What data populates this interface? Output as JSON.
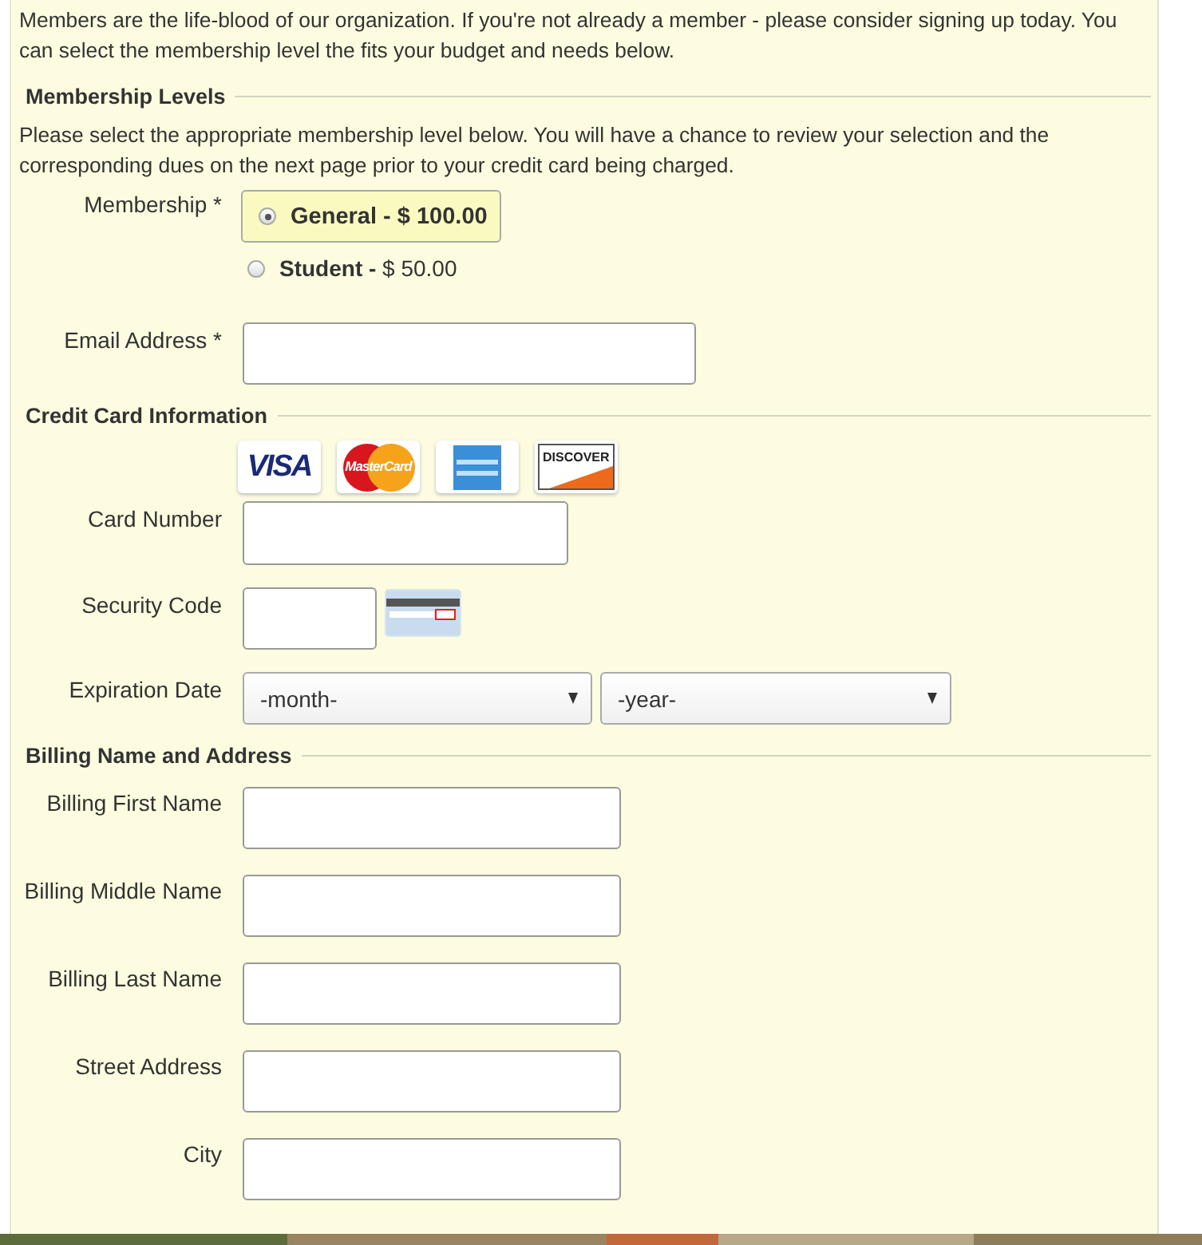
{
  "intro": "Members are the life-blood of our organization. If you're not already a member - please consider signing up today. You can select the membership level the fits your budget and needs below.",
  "membership_section": {
    "title": "Membership Levels",
    "note": "Please select the appropriate membership level below. You will have a chance to review your selection and the corresponding dues on the next page prior to your credit card being charged.",
    "label": "Membership *",
    "options": [
      {
        "name": "General - ",
        "price": "$ 100.00",
        "selected": true
      },
      {
        "name": "Student - ",
        "price": "$ 50.00",
        "selected": false
      }
    ]
  },
  "email": {
    "label": "Email Address *"
  },
  "credit_card_section": {
    "title": "Credit Card Information",
    "card_logos": [
      {
        "kind": "visa",
        "text": "VISA"
      },
      {
        "kind": "mastercard",
        "text": "MasterCard"
      },
      {
        "kind": "amex"
      },
      {
        "kind": "discover",
        "text": "DISCOVER"
      }
    ],
    "card_number": {
      "label": "Card Number"
    },
    "security_code": {
      "label": "Security Code"
    },
    "expiration": {
      "label": "Expiration Date",
      "month": "-month-",
      "year": "-year-"
    }
  },
  "billing_section": {
    "title": "Billing Name and Address",
    "fields": [
      {
        "label": "Billing First Name"
      },
      {
        "label": "Billing Middle Name"
      },
      {
        "label": "Billing Last Name"
      },
      {
        "label": "Street Address"
      },
      {
        "label": "City"
      }
    ]
  }
}
